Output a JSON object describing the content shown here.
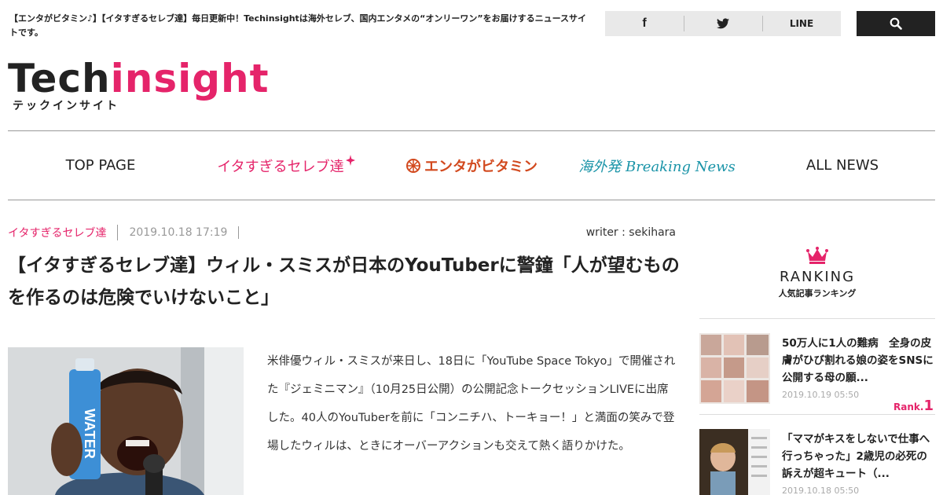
{
  "header": {
    "tagline": "【エンタがビタミン♪】【イタすぎるセレブ達】毎日更新中！Techinsightは海外セレブ、国内エンタメの“オンリーワン”をお届けするニュースサイトです。",
    "social": {
      "facebook": "f",
      "line": "LINE"
    },
    "logo": {
      "tech": "Tech",
      "insight": "insight",
      "sub": "テックインサイト"
    }
  },
  "nav": {
    "top": "TOP PAGE",
    "celeb": "イタすぎるセレブ達",
    "enta": "エンタがビタミン",
    "kaigai": "海外発 Breaking News",
    "all": "ALL NEWS"
  },
  "article": {
    "category": "イタすぎるセレブ達",
    "date": "2019.10.18 17:19",
    "writer": "writer : sekihara",
    "title": "【イタすぎるセレブ達】ウィル・スミスが日本のYouTuberに警鐘「人が望むものを作るのは危険でいけないこと」",
    "body": "米俳優ウィル・スミスが来日し、18日に「YouTube Space Tokyo」で開催された『ジェミニマン』（10月25日公開）の公開記念トークセッションLIVEに出席した。40人のYouTuberを前に「コンニチハ、トーキョー！」と満面の笑みで登場したウィルは、ときにオーバーアクションも交えて熱く語りかけた。",
    "photo_text": "WATER"
  },
  "ranking": {
    "title": "RANKING",
    "subtitle": "人気記事ランキング",
    "items": [
      {
        "title": "50万人に1人の難病　全身の皮膚がひび割れる娘の姿をSNSに公開する母の願...",
        "date": "2019.10.19 05:50",
        "rank_label": "Rank.",
        "rank_num": "1"
      },
      {
        "title": "「ママがキスをしないで仕事へ行っちゃった」2歳児の必死の訴えが超キュート（...",
        "date": "2019.10.18 05:50"
      }
    ]
  },
  "colors": {
    "accent": "#e5246a",
    "enta": "#d2491e",
    "kaigai": "#1a94a8"
  }
}
